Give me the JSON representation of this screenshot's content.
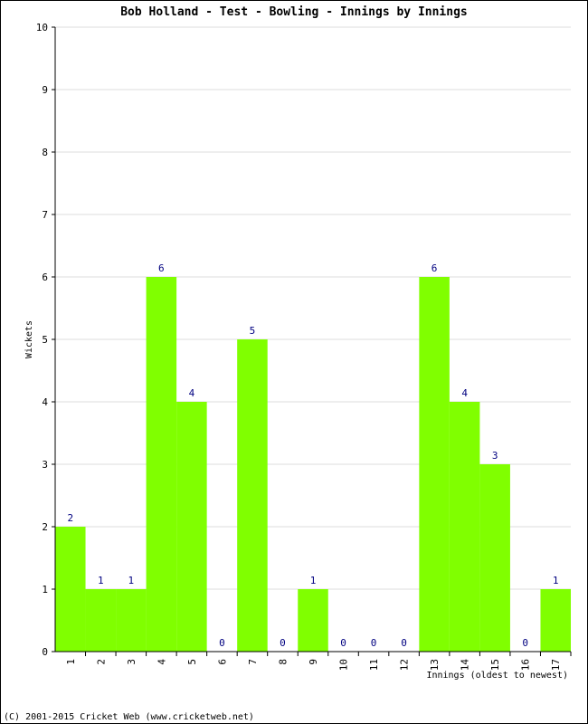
{
  "chart_data": {
    "type": "bar",
    "title": "Bob Holland - Test - Bowling - Innings by Innings",
    "xlabel": "Innings (oldest to newest)",
    "ylabel": "Wickets",
    "categories": [
      "1",
      "2",
      "3",
      "4",
      "5",
      "6",
      "7",
      "8",
      "9",
      "10",
      "11",
      "12",
      "13",
      "14",
      "15",
      "16",
      "17"
    ],
    "values": [
      2,
      1,
      1,
      6,
      4,
      0,
      5,
      0,
      1,
      0,
      0,
      0,
      6,
      4,
      3,
      0,
      1
    ],
    "ylim": [
      0,
      10
    ],
    "yticks": [
      "0",
      "1",
      "2",
      "3",
      "4",
      "5",
      "6",
      "7",
      "8",
      "9",
      "10"
    ],
    "grid": true,
    "bar_color": "#80ff00",
    "label_color": "#000080"
  },
  "footer": "(C) 2001-2015 Cricket Web (www.cricketweb.net)"
}
